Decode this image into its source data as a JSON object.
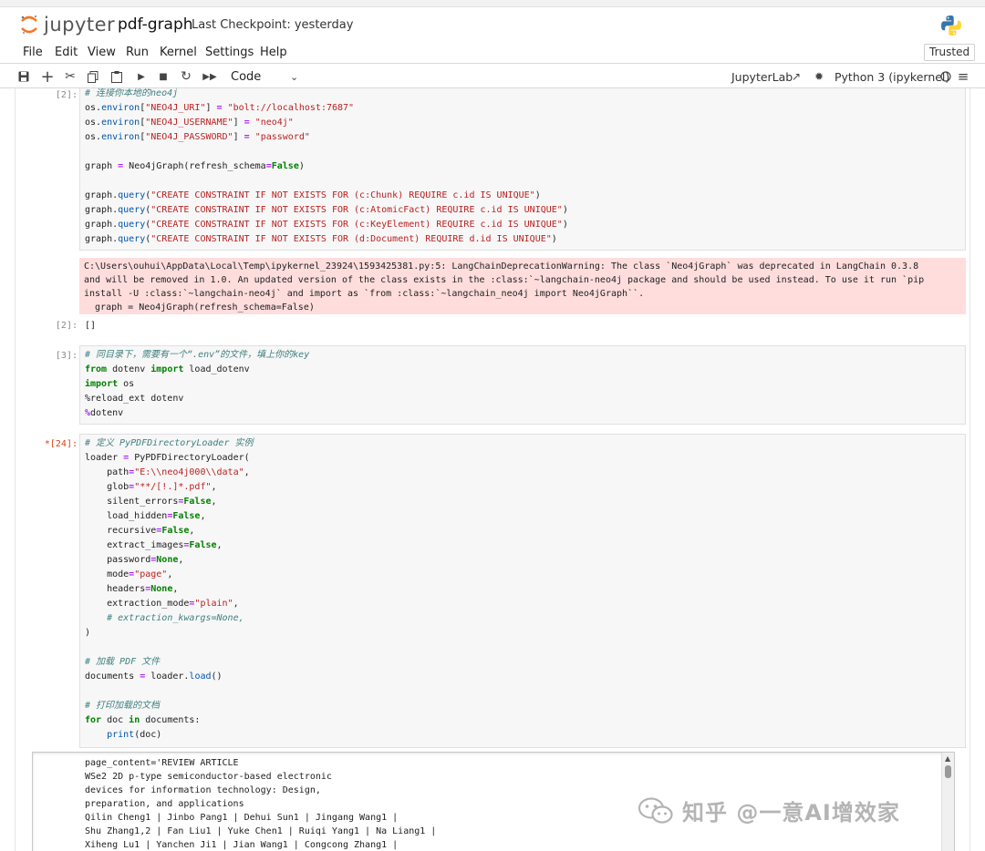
{
  "header": {
    "logo_text": "jupyter",
    "notebook_title": "pdf-graph",
    "checkpoint": "Last Checkpoint: yesterday"
  },
  "menu": {
    "items": [
      "File",
      "Edit",
      "View",
      "Run",
      "Kernel",
      "Settings",
      "Help"
    ],
    "trusted": "Trusted"
  },
  "toolbar": {
    "icons": [
      "save-icon",
      "add-icon",
      "cut-icon",
      "copy-icon",
      "paste-icon",
      "run-icon",
      "stop-icon",
      "restart-icon",
      "fast-forward-icon"
    ],
    "cell_type": "Code",
    "jupyterlab_link": "JupyterLab",
    "kernel": "Python 3 (ipykernel)"
  },
  "cells": {
    "c1": {
      "prompt": "[2]:",
      "out_prompt": "[2]:",
      "output": "[]",
      "stderr": [
        "C:\\Users\\ouhui\\AppData\\Local\\Temp\\ipykernel_23924\\1593425381.py:5: LangChainDeprecationWarning: The class `Neo4jGraph` was deprecated in LangChain 0.3.8",
        "and will be removed in 1.0. An updated version of the class exists in the :class:`~langchain-neo4j package and should be used instead. To use it run `pip",
        "install -U :class:`~langchain-neo4j` and import as `from :class:`~langchain_neo4j import Neo4jGraph``.",
        "  graph = Neo4jGraph(refresh_schema=False)"
      ]
    },
    "c2": {
      "prompt": "[3]:"
    },
    "c3": {
      "prompt": "*[24]:"
    }
  },
  "scroll_output": {
    "lines": [
      "page_content='REVIEW ARTICLE",
      "WSe2 2D p-type semiconductor-based electronic",
      "devices for information technology: Design,",
      "preparation, and applications",
      "Qilin Cheng1 | Jinbo Pang1 | Dehui Sun1 | Jingang Wang1 |",
      "Shu Zhang1,2 | Fan Liu1 | Yuke Chen1 | Ruiqi Yang1 | Na Liang1 |",
      "Xiheng Lu1 | Yanchen Ji1 | Jian Wang1 | Congcong Zhang1 |"
    ]
  },
  "watermark": "知乎 @一意AI增效家",
  "colors": {
    "cell_bg": "#f7f7f7",
    "stderr_bg": "#ffdddd",
    "keyword": "#008000",
    "string": "#ba2121",
    "comment": "#408080",
    "jupyter_orange": "#f37726"
  }
}
